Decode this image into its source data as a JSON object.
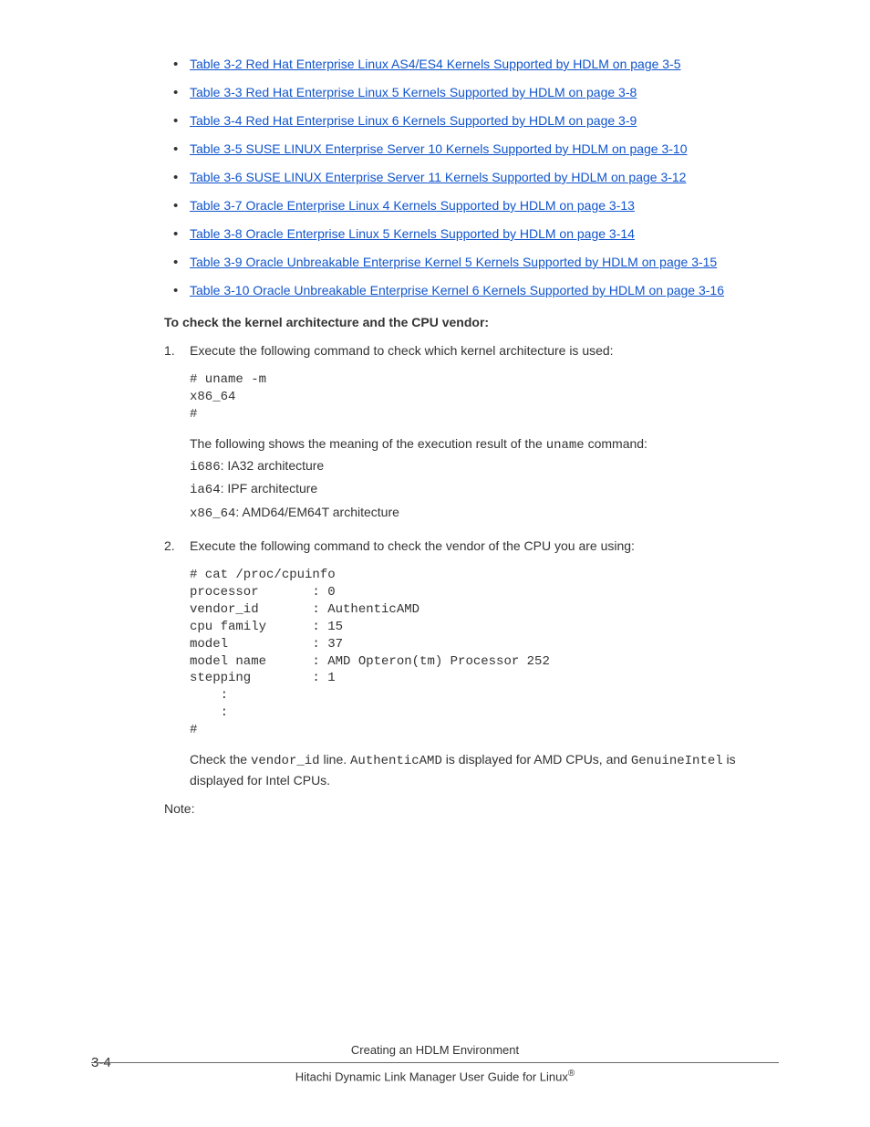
{
  "bullets": [
    "Table 3-2 Red Hat Enterprise Linux AS4/ES4 Kernels Supported by HDLM on page 3-5",
    "Table 3-3 Red Hat Enterprise Linux 5 Kernels Supported by HDLM on page 3-8",
    "Table 3-4 Red Hat Enterprise Linux 6 Kernels Supported by HDLM on page 3-9",
    "Table 3-5 SUSE LINUX Enterprise Server 10 Kernels Supported by HDLM on page 3-10",
    "Table 3-6 SUSE LINUX Enterprise Server 11 Kernels Supported by HDLM on page 3-12",
    "Table 3-7 Oracle Enterprise Linux 4 Kernels Supported by HDLM on page 3-13",
    "Table 3-8 Oracle Enterprise Linux 5 Kernels Supported by HDLM on page 3-14",
    "Table 3-9 Oracle Unbreakable Enterprise Kernel 5 Kernels Supported by HDLM on page 3-15",
    "Table 3-10 Oracle Unbreakable Enterprise Kernel 6 Kernels Supported by HDLM on page 3-16"
  ],
  "headline": "To check the kernel architecture and the CPU vendor:",
  "steps": {
    "s1": {
      "intro": "Execute the following command to check which kernel architecture is used:",
      "code": "# uname -m\nx86_64\n#",
      "explain_pre": "The following shows the meaning of the execution result of the ",
      "explain_cmd": "uname",
      "explain_post": " command:",
      "arch": [
        {
          "code": "i686",
          "desc": ": IA32 architecture"
        },
        {
          "code": "ia64",
          "desc": ": IPF architecture"
        },
        {
          "code": "x86_64",
          "desc": ": AMD64/EM64T architecture"
        }
      ]
    },
    "s2": {
      "intro": "Execute the following command to check the vendor of the CPU you are using:",
      "code": "# cat /proc/cpuinfo\nprocessor       : 0\nvendor_id       : AuthenticAMD\ncpu family      : 15\nmodel           : 37\nmodel name      : AMD Opteron(tm) Processor 252\nstepping        : 1\n    :\n    :\n#",
      "tail_parts": {
        "t0": "Check the ",
        "t1": "vendor_id",
        "t2": " line. ",
        "t3": "AuthenticAMD",
        "t4": " is displayed for AMD CPUs, and ",
        "t5": "GenuineIntel",
        "t6": " is displayed for Intel CPUs."
      }
    }
  },
  "note_label": "Note:",
  "footer": {
    "title": "Creating an HDLM Environment",
    "guide_pre": "Hitachi Dynamic Link Manager User Guide for Linux",
    "reg": "®"
  },
  "page_number": "3-4"
}
